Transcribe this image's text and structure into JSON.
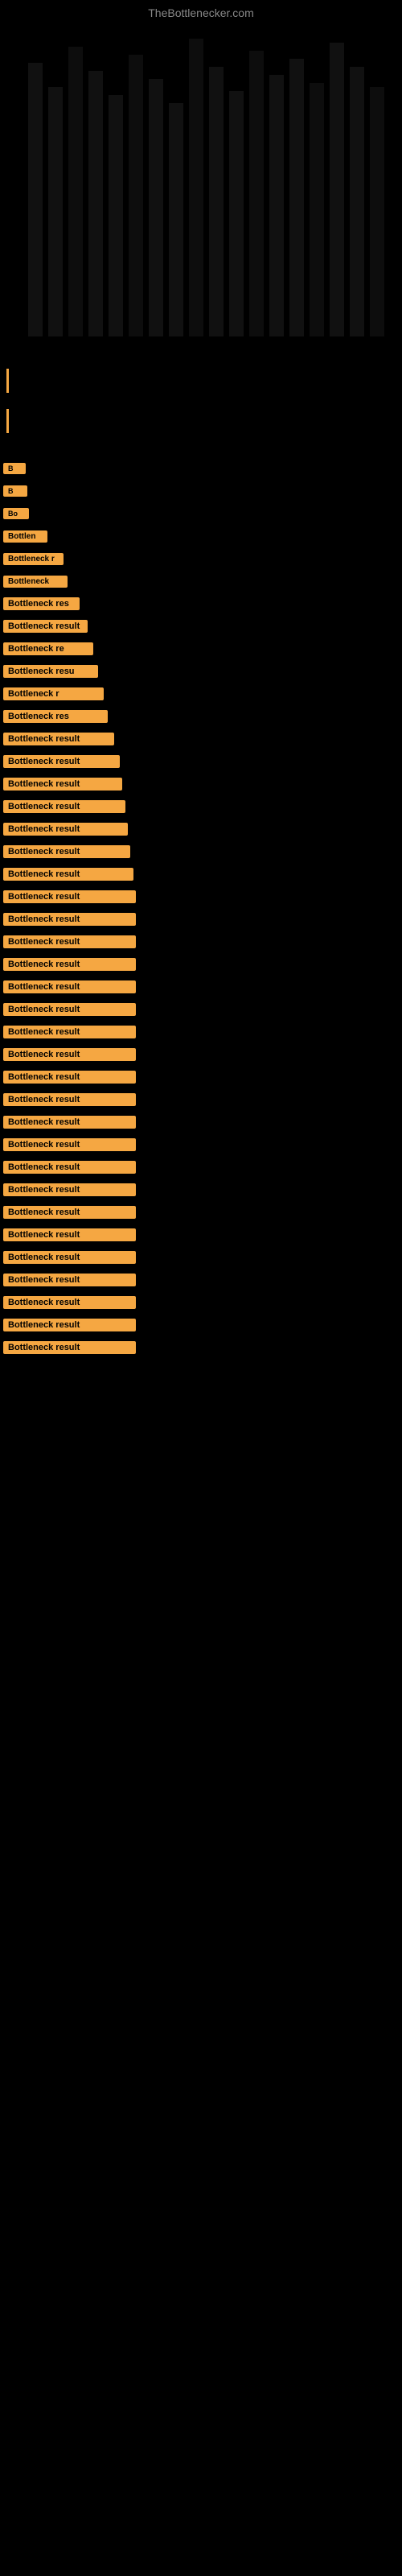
{
  "site": {
    "title": "TheBottlenecker.com"
  },
  "results": [
    {
      "id": 1,
      "label": "Bottleneck result",
      "width_class": "badge-w1",
      "margin_top": 430
    },
    {
      "id": 2,
      "label": "Bottleneck result",
      "width_class": "badge-w2",
      "margin_top": 10
    },
    {
      "id": 3,
      "label": "Bottleneck result",
      "width_class": "badge-w3",
      "margin_top": 10
    },
    {
      "id": 4,
      "label": "Bottleneck result",
      "width_class": "badge-w4",
      "margin_top": 10
    },
    {
      "id": 5,
      "label": "Bottleneck result",
      "width_class": "badge-w5",
      "margin_top": 10
    },
    {
      "id": 6,
      "label": "Bottleneck result",
      "width_class": "badge-w6",
      "margin_top": 10
    },
    {
      "id": 7,
      "label": "Bottleneck result",
      "width_class": "badge-w7",
      "margin_top": 10
    },
    {
      "id": 8,
      "label": "Bottleneck result",
      "width_class": "badge-w8",
      "margin_top": 10
    },
    {
      "id": 9,
      "label": "Bottleneck result",
      "width_class": "badge-w9",
      "margin_top": 10
    },
    {
      "id": 10,
      "label": "Bottleneck result",
      "width_class": "badge-w10",
      "margin_top": 10
    },
    {
      "id": 11,
      "label": "Bottleneck result",
      "width_class": "badge-w11",
      "margin_top": 10
    },
    {
      "id": 12,
      "label": "Bottleneck result",
      "width_class": "badge-w12",
      "margin_top": 10
    },
    {
      "id": 13,
      "label": "Bottleneck result",
      "width_class": "badge-w13",
      "margin_top": 10
    },
    {
      "id": 14,
      "label": "Bottleneck result",
      "width_class": "badge-w14",
      "margin_top": 10
    },
    {
      "id": 15,
      "label": "Bottleneck result",
      "width_class": "badge-w15",
      "margin_top": 10
    },
    {
      "id": 16,
      "label": "Bottleneck result",
      "width_class": "badge-w16",
      "margin_top": 10
    },
    {
      "id": 17,
      "label": "Bottleneck result",
      "width_class": "badge-w17",
      "margin_top": 10
    },
    {
      "id": 18,
      "label": "Bottleneck result",
      "width_class": "badge-w18",
      "margin_top": 10
    },
    {
      "id": 19,
      "label": "Bottleneck result",
      "width_class": "badge-w19",
      "margin_top": 10
    },
    {
      "id": 20,
      "label": "Bottleneck result",
      "width_class": "badge-w20",
      "margin_top": 10
    }
  ]
}
